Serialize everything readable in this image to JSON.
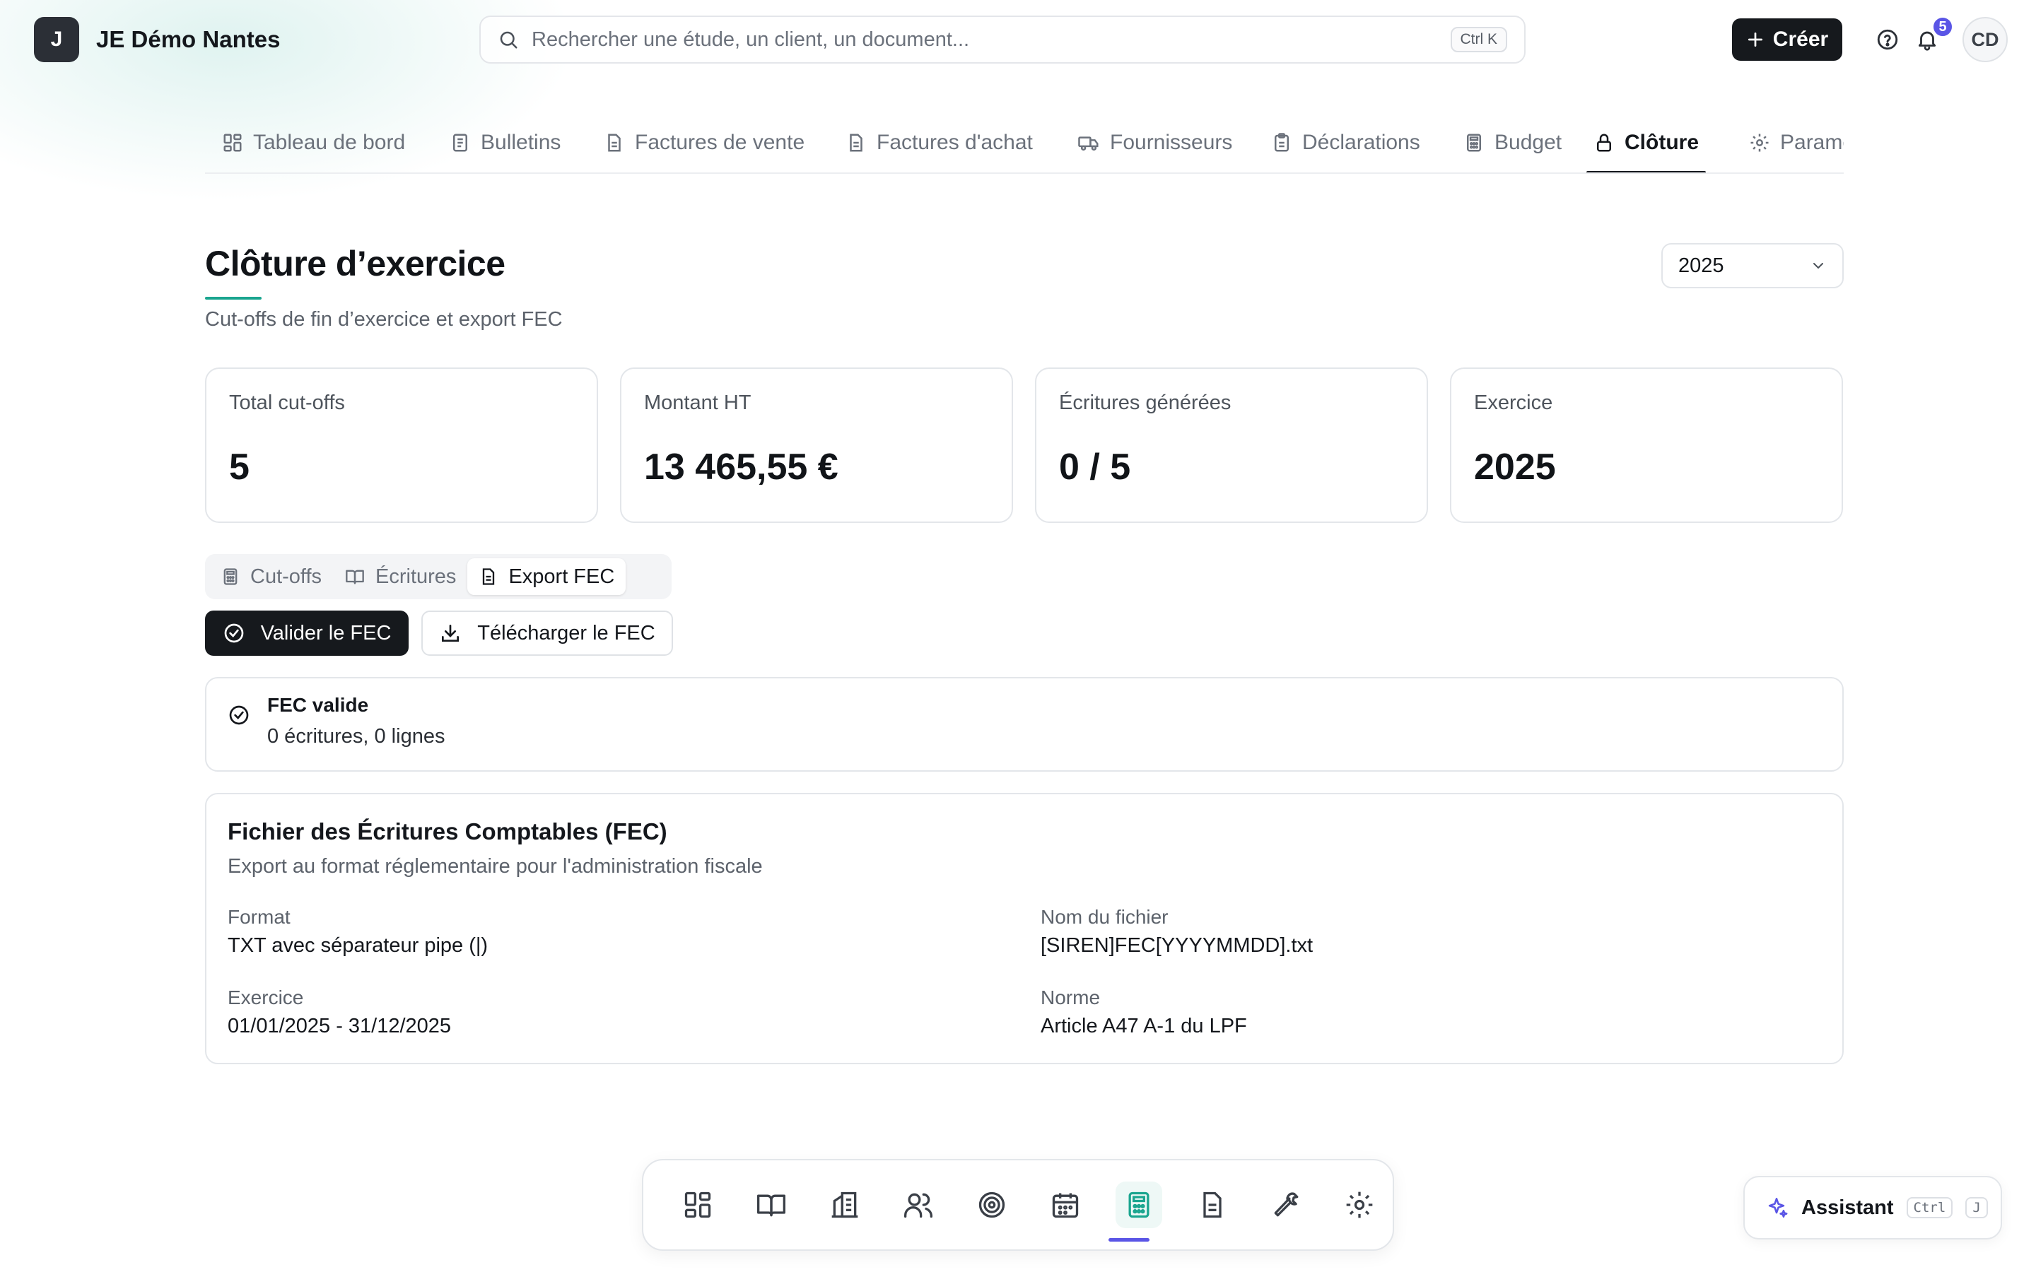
{
  "app": {
    "logo_letter": "J",
    "name": "JE Démo Nantes"
  },
  "search": {
    "placeholder": "Rechercher une étude, un client, un document...",
    "shortcut": "Ctrl K"
  },
  "header": {
    "create_label": "Créer",
    "notification_count": "5",
    "avatar_initials": "CD"
  },
  "tabs": [
    {
      "label": "Tableau de bord",
      "icon": "dashboard-icon"
    },
    {
      "label": "Bulletins",
      "icon": "document-icon"
    },
    {
      "label": "Factures de vente",
      "icon": "invoice-icon"
    },
    {
      "label": "Factures d'achat",
      "icon": "invoice-icon"
    },
    {
      "label": "Fournisseurs",
      "icon": "truck-icon"
    },
    {
      "label": "Déclarations",
      "icon": "clipboard-icon"
    },
    {
      "label": "Budget",
      "icon": "calculator-icon"
    },
    {
      "label": "Clôture",
      "icon": "lock-icon",
      "active": true
    },
    {
      "label": "Paramè",
      "icon": "gear-icon"
    }
  ],
  "page": {
    "title": "Clôture d’exercice",
    "subtitle": "Cut-offs de fin d’exercice et export FEC",
    "year_selected": "2025"
  },
  "stats": [
    {
      "label": "Total cut-offs",
      "value": "5"
    },
    {
      "label": "Montant HT",
      "value": "13 465,55 €"
    },
    {
      "label": "Écritures générées",
      "value": "0 / 5"
    },
    {
      "label": "Exercice",
      "value": "2025"
    }
  ],
  "segments": [
    {
      "label": "Cut-offs",
      "icon": "calculator-icon"
    },
    {
      "label": "Écritures",
      "icon": "book-icon"
    },
    {
      "label": "Export FEC",
      "icon": "document-icon",
      "active": true
    }
  ],
  "actions": {
    "validate_label": "Valider le FEC",
    "download_label": "Télécharger le FEC"
  },
  "alert": {
    "title": "FEC valide",
    "description": "0 écritures, 0 lignes"
  },
  "fec": {
    "title": "Fichier des Écritures Comptables (FEC)",
    "subtitle": "Export au format réglementaire pour l'administration fiscale",
    "fields": [
      {
        "label": "Format",
        "value": "TXT avec séparateur pipe (|)"
      },
      {
        "label": "Nom du fichier",
        "value": "[SIREN]FEC[YYYYMMDD].txt"
      },
      {
        "label": "Exercice",
        "value": "01/01/2025 - 31/12/2025"
      },
      {
        "label": "Norme",
        "value": "Article A47 A-1 du LPF"
      }
    ]
  },
  "dock": [
    "dashboard-icon",
    "book-icon",
    "building-icon",
    "users-icon",
    "target-icon",
    "calendar-icon",
    "calculator-icon",
    "document-icon",
    "wrench-icon",
    "gear-icon"
  ],
  "assistant": {
    "label": "Assistant",
    "key1": "Ctrl",
    "key2": "J"
  },
  "colors": {
    "accent": "#1aa58f",
    "badge": "#5a55e6",
    "dark": "#16191d"
  }
}
